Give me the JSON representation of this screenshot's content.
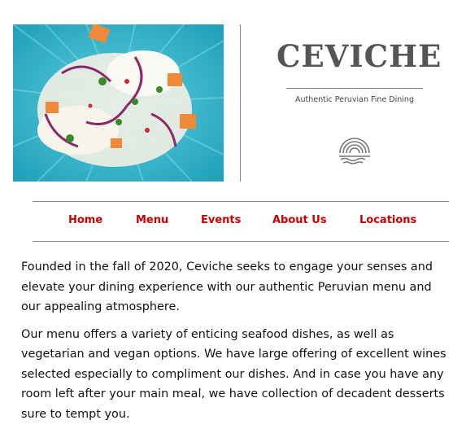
{
  "header": {
    "image_alt": "plate of ceviche on a turquoise plate",
    "brand_title": "CEVICHE",
    "tagline": "Authentic Peruvian Fine Dining",
    "logo_icon": "shell-icon"
  },
  "nav": {
    "items": [
      {
        "label": "Home"
      },
      {
        "label": "Menu"
      },
      {
        "label": "Events"
      },
      {
        "label": "About Us"
      },
      {
        "label": "Locations"
      }
    ],
    "link_color": "#cc0000"
  },
  "content": {
    "paragraphs": [
      "Founded in the fall of 2020, Ceviche seeks to engage your senses and elevate your dining experience with our authentic Peruvian menu and our appealing atmosphere.",
      "Our menu offers a variety of enticing seafood dishes, as well as vegetarian and vegan options. We have large offering of excellent wines selected especially to compliment our dishes. And in case you have any room left after your main meal, we have collection of decadent desserts sure to tempt you."
    ]
  }
}
